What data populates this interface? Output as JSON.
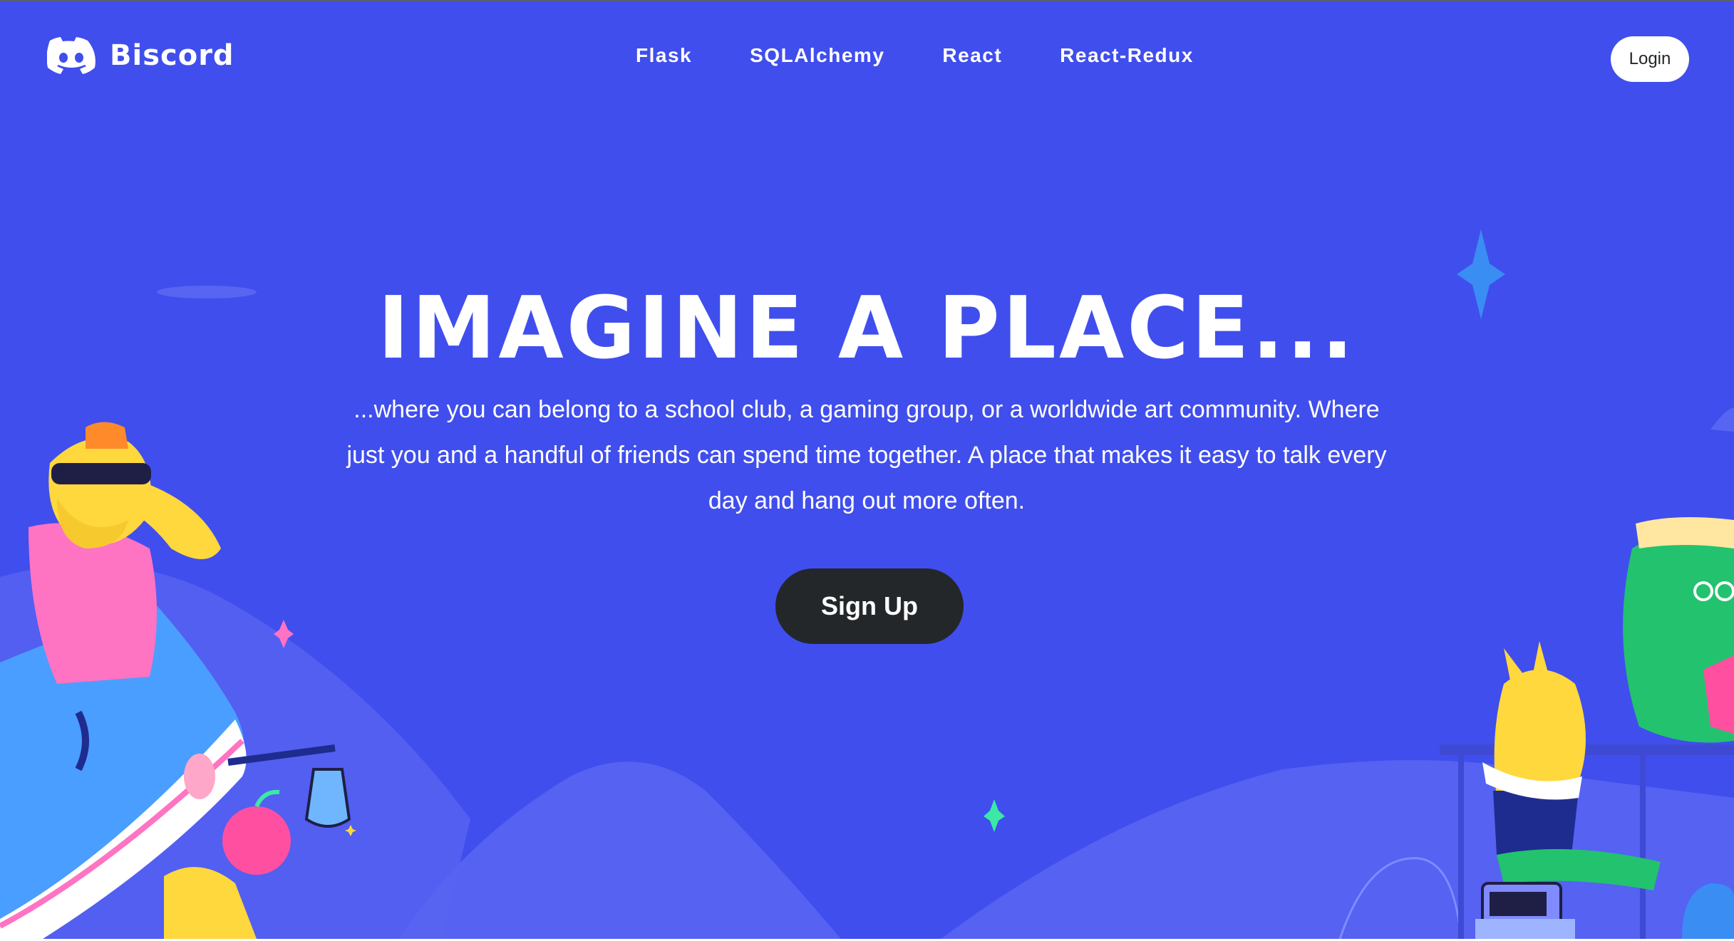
{
  "nav": {
    "brand": "Biscord",
    "links": [
      "Flask",
      "SQLAlchemy",
      "React",
      "React-Redux"
    ],
    "login_label": "Login"
  },
  "hero": {
    "headline": "IMAGINE A PLACE...",
    "tagline": "...where you can belong to a school club, a gaming group, or a worldwide art community. Where just you and a handful of friends can spend time together. A place that makes it easy to talk every day and hang out more often.",
    "signup_label": "Sign Up"
  },
  "colors": {
    "background": "#404EED",
    "button_dark": "#23272A",
    "text": "#FFFFFF"
  },
  "icons": [
    "discord-logo-icon",
    "sparkle-icon",
    "cloud-icon"
  ]
}
